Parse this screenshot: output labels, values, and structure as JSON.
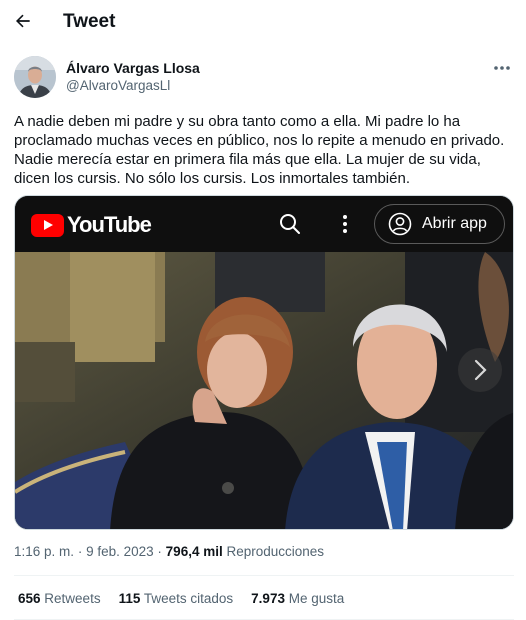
{
  "header": {
    "title": "Tweet",
    "back_icon": "arrow-left-icon"
  },
  "author": {
    "name": "Álvaro Vargas Llosa",
    "handle": "@AlvaroVargasLl",
    "more_icon": "more-horizontal-icon"
  },
  "tweet": {
    "text": "A nadie deben mi padre y su obra tanto como a ella. Mi padre lo ha proclamado muchas veces en público, nos lo repite a menudo en privado. Nadie merecía estar en primera fila más que ella. La mujer de su vida, dicen los cursis. No sólo los cursis. Los inmortales también."
  },
  "media": {
    "brand": "YouTube",
    "open_app_label": "Abrir app",
    "icons": [
      "youtube-logo-icon",
      "search-icon",
      "more-vertical-icon",
      "account-icon",
      "chevron-right-icon"
    ]
  },
  "meta": {
    "time": "1:16 p. m.",
    "separator": "·",
    "date": "9 feb. 2023",
    "views": "796,4 mil",
    "views_label": "Reproducciones"
  },
  "stats": {
    "retweets_count": "656",
    "retweets_label": "Retweets",
    "quotes_count": "115",
    "quotes_label": "Tweets citados",
    "likes_count": "7.973",
    "likes_label": "Me gusta"
  },
  "colors": {
    "text": "#0f1419",
    "secondary": "#536471",
    "divider": "#eff3f4",
    "youtube_red": "#ff0000",
    "youtube_bar": "#0f0f0f"
  }
}
